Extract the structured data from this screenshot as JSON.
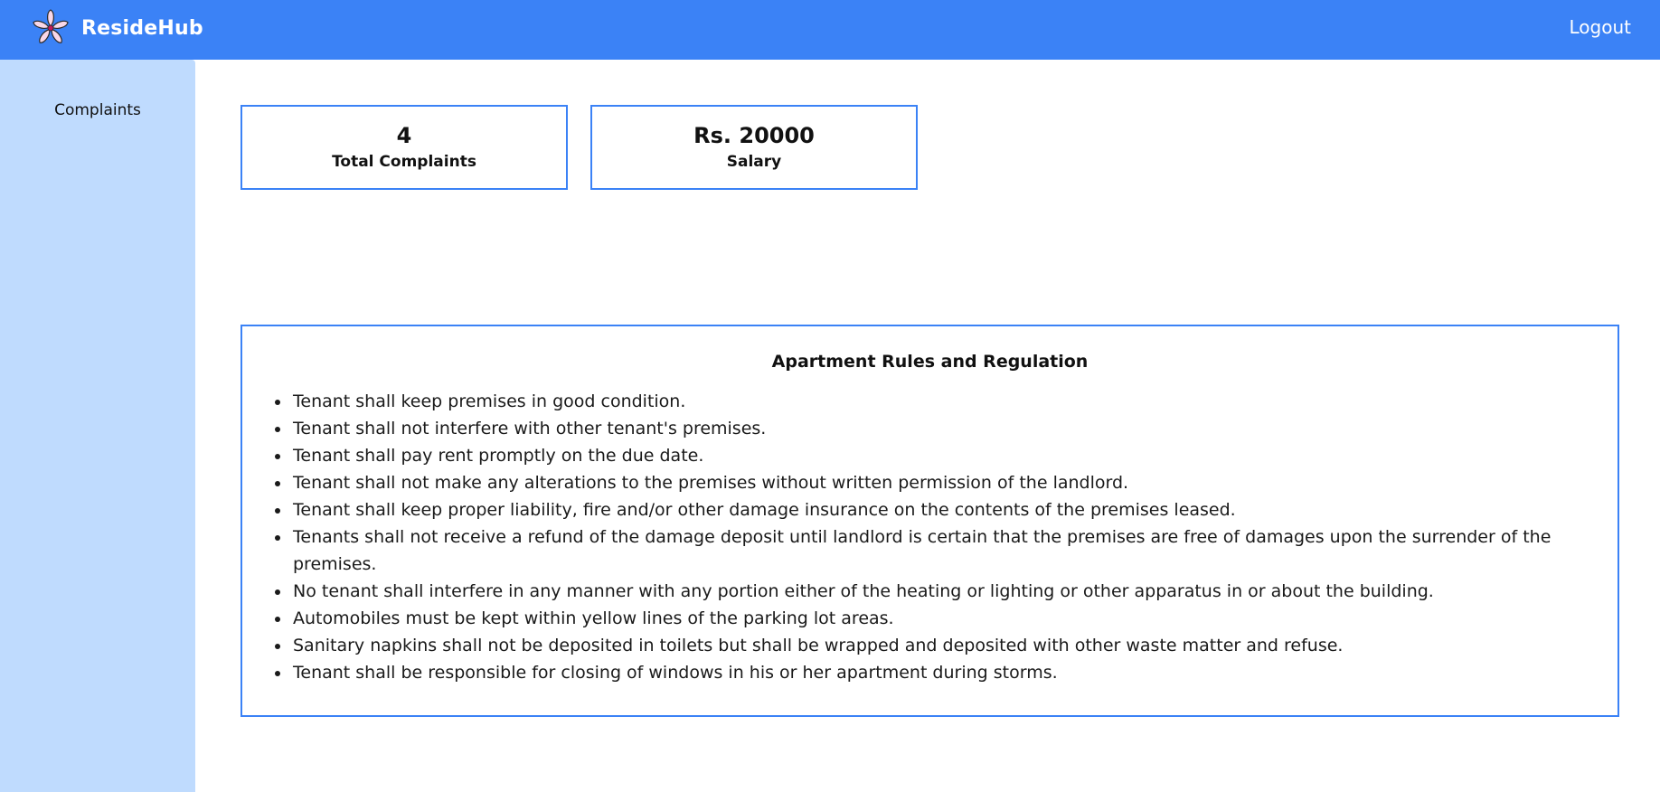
{
  "header": {
    "brand": "ResideHub",
    "logo_icon": "flower-logo-icon",
    "logout_label": "Logout",
    "bg_color": "#3b82f6"
  },
  "sidebar": {
    "items": [
      {
        "label": "Complaints"
      }
    ],
    "bg_color": "#bfdbfe"
  },
  "stats": [
    {
      "value": "4",
      "label": "Total Complaints"
    },
    {
      "value": "Rs. 20000",
      "label": "Salary"
    }
  ],
  "rules": {
    "title": "Apartment Rules and Regulation",
    "items": [
      "Tenant shall keep premises in good condition.",
      "Tenant shall not interfere with other tenant's premises.",
      "Tenant shall pay rent promptly on the due date.",
      "Tenant shall not make any alterations to the premises without written permission of the landlord.",
      "Tenant shall keep proper liability, fire and/or other damage insurance on the contents of the premises leased.",
      "Tenants shall not receive a refund of the damage deposit until landlord is certain that the premises are free of damages upon the surrender of the premises.",
      "No tenant shall interfere in any manner with any portion either of the heating or lighting or other apparatus in or about the building.",
      "Automobiles must be kept within yellow lines of the parking lot areas.",
      "Sanitary napkins shall not be deposited in toilets but shall be wrapped and deposited with other waste matter and refuse.",
      "Tenant shall be responsible for closing of windows in his or her apartment during storms."
    ]
  }
}
